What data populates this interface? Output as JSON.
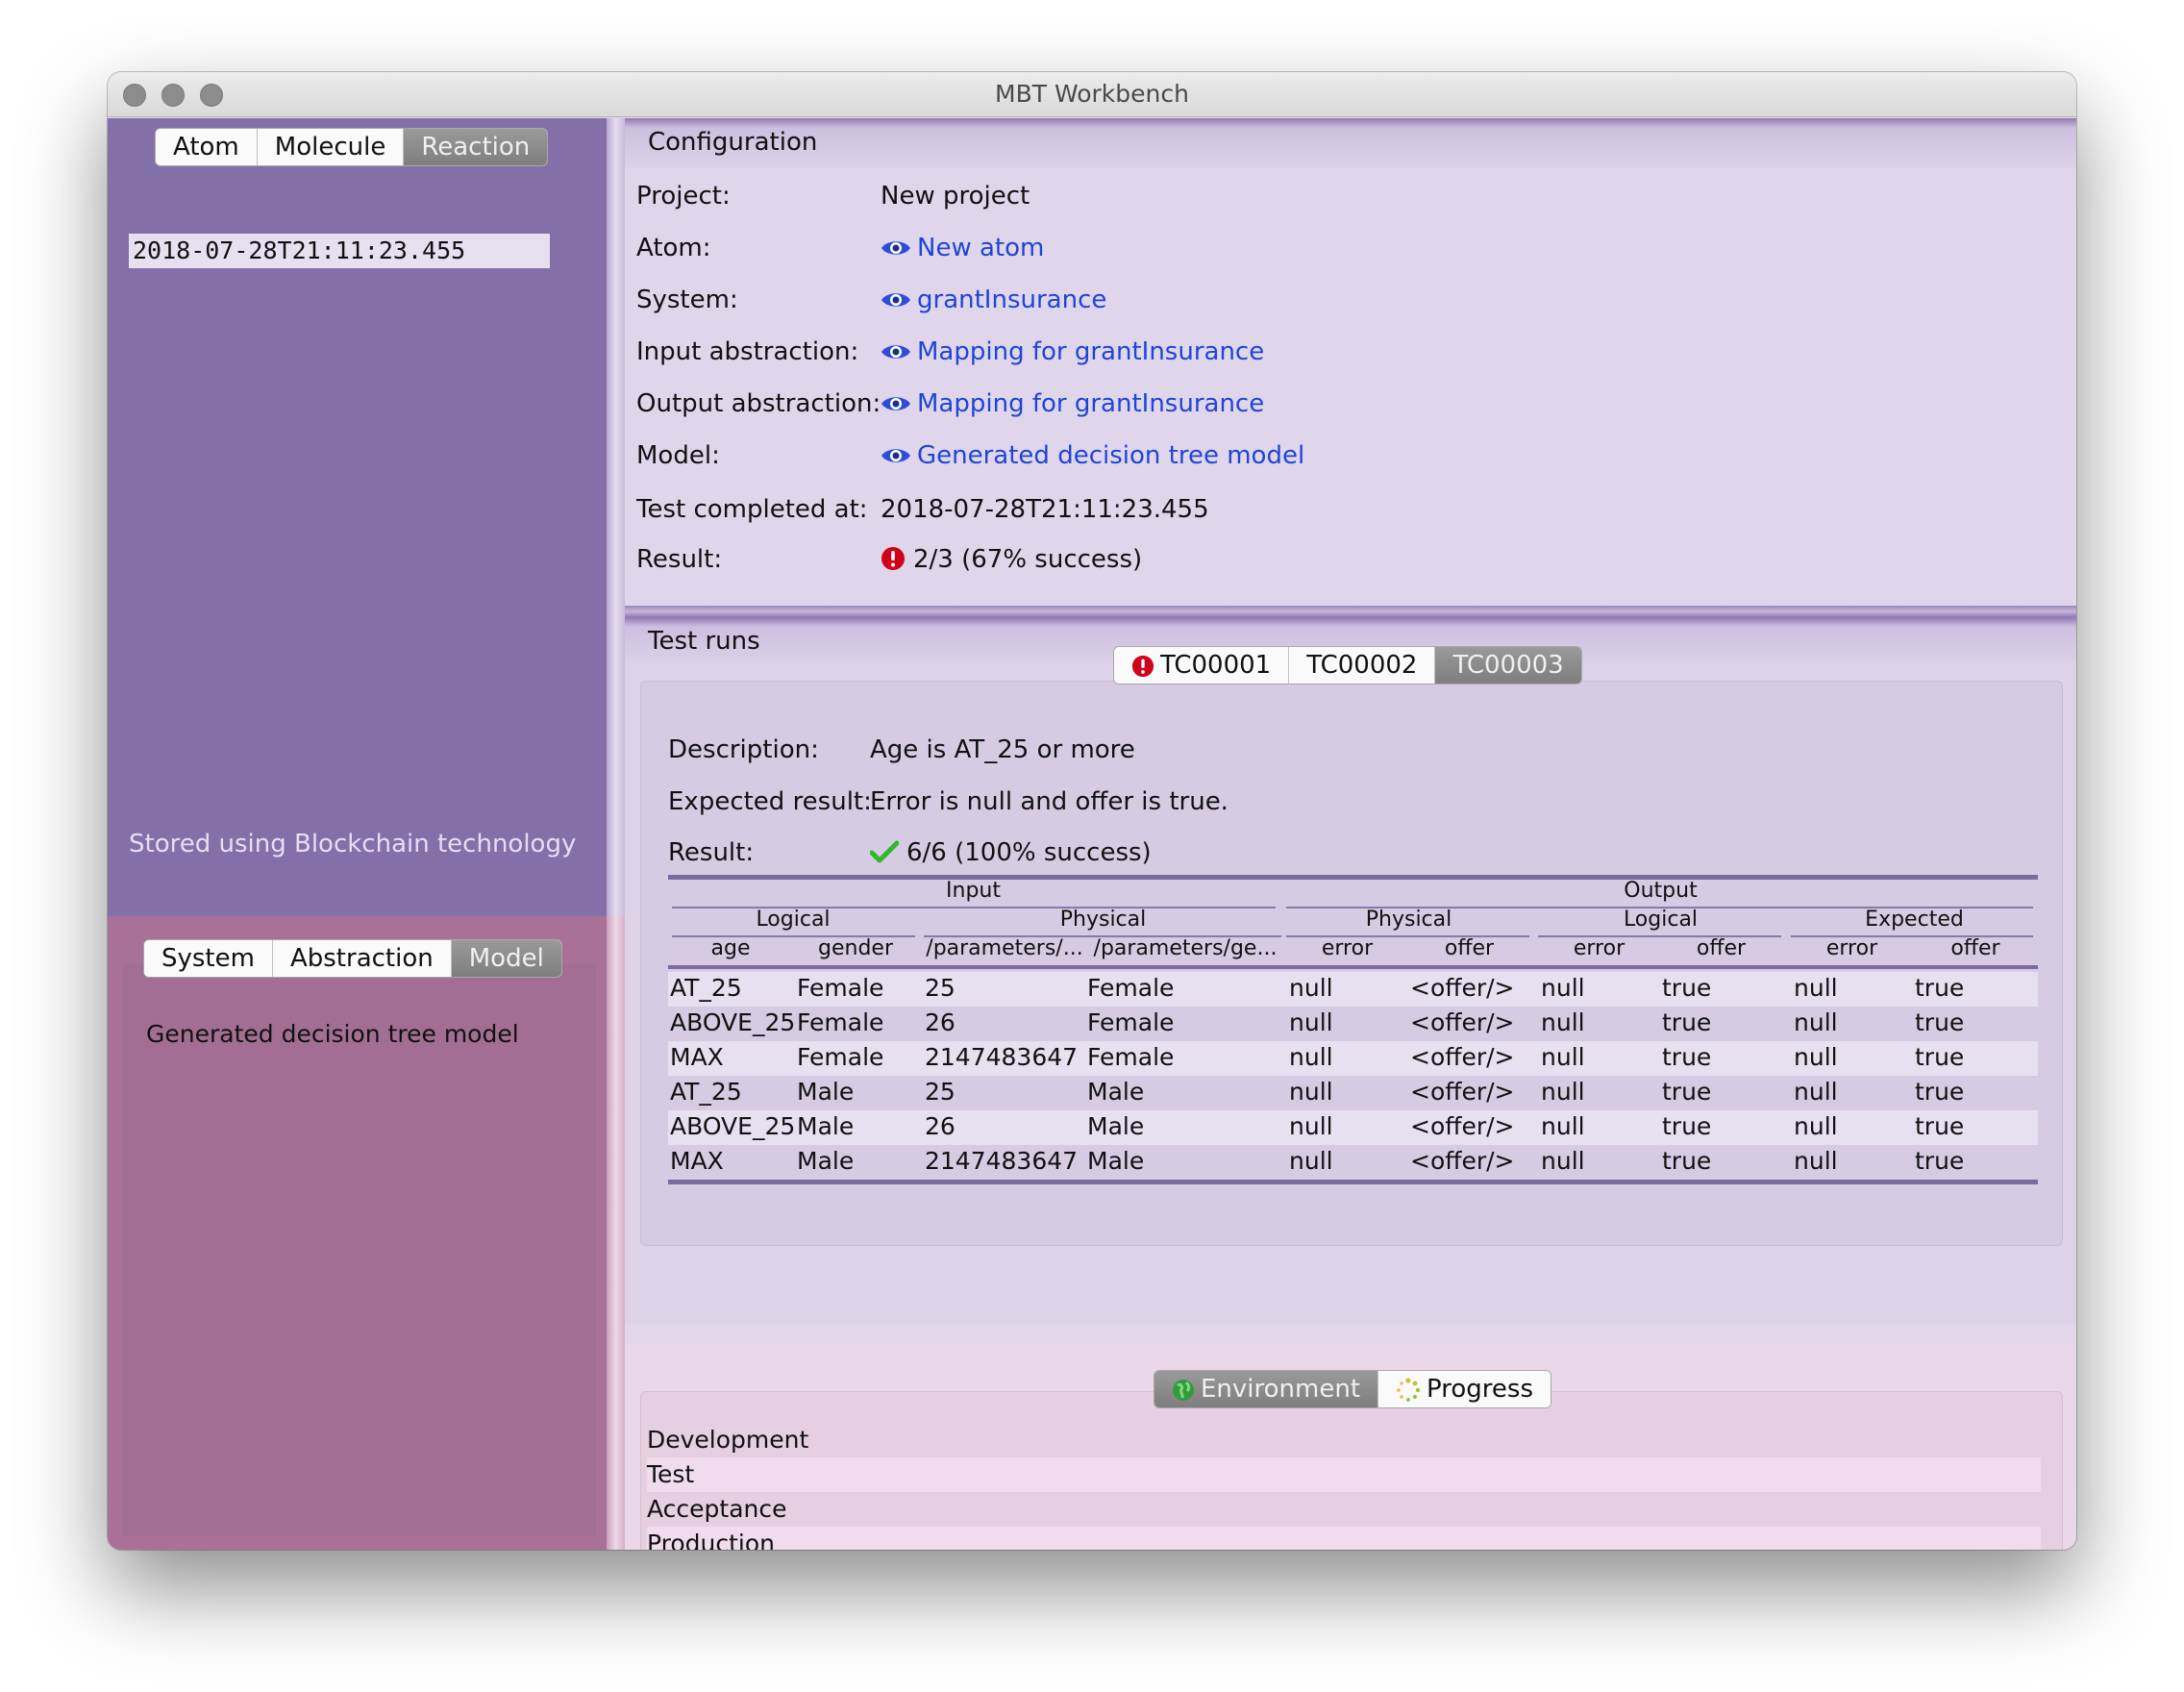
{
  "window": {
    "title": "MBT Workbench"
  },
  "left_top": {
    "tabs": [
      {
        "label": "Atom",
        "selected": false
      },
      {
        "label": "Molecule",
        "selected": false
      },
      {
        "label": "Reaction",
        "selected": true
      }
    ],
    "timestamp": "2018-07-28T21:11:23.455",
    "footer": "Stored using Blockchain technology"
  },
  "left_bottom": {
    "tabs": [
      {
        "label": "System",
        "selected": false
      },
      {
        "label": "Abstraction",
        "selected": false
      },
      {
        "label": "Model",
        "selected": true
      }
    ],
    "model_name": "Generated decision tree model"
  },
  "configuration": {
    "heading": "Configuration",
    "project_label": "Project:",
    "project_value": "New project",
    "atom_label": "Atom:",
    "atom_value": "New atom",
    "system_label": "System:",
    "system_value": "grantInsurance",
    "input_label": "Input abstraction:",
    "input_value": "Mapping for grantInsurance",
    "output_label": "Output abstraction:",
    "output_value": "Mapping for grantInsurance",
    "model_label": "Model:",
    "model_value": "Generated decision tree model",
    "completed_label": "Test completed at:",
    "completed_value": "2018-07-28T21:11:23.455",
    "result_label": "Result:",
    "result_value": "2/3 (67% success)",
    "result_status": "error",
    "link_color": "#1f45d6",
    "error_color": "#d0021b"
  },
  "test_runs": {
    "heading": "Test runs",
    "tabs": [
      {
        "label": "TC00001",
        "icon": "error-icon",
        "selected": false
      },
      {
        "label": "TC00002",
        "selected": false
      },
      {
        "label": "TC00003",
        "selected": true
      }
    ],
    "description_label": "Description:",
    "description_value": "Age is AT_25 or more",
    "expected_label": "Expected result:",
    "expected_value": "Error is null and offer is true.",
    "result_label": "Result:",
    "result_value": "6/6 (100% success)",
    "result_status": "success",
    "success_color": "#2fb82a",
    "table": {
      "group_input": "Input",
      "group_output": "Output",
      "sub_logical": "Logical",
      "sub_physical_in": "Physical",
      "sub_physical_out": "Physical",
      "sub_logical_out": "Logical",
      "sub_expected": "Expected",
      "columns": [
        "age",
        "gender",
        "/parameters/...",
        "/parameters/ge...",
        "error",
        "offer",
        "error",
        "offer",
        "error",
        "offer"
      ],
      "rows": [
        [
          "AT_25",
          "Female",
          "25",
          "Female",
          "null",
          "<offer/>",
          "null",
          "true",
          "null",
          "true"
        ],
        [
          "ABOVE_25",
          "Female",
          "26",
          "Female",
          "null",
          "<offer/>",
          "null",
          "true",
          "null",
          "true"
        ],
        [
          "MAX",
          "Female",
          "2147483647",
          "Female",
          "null",
          "<offer/>",
          "null",
          "true",
          "null",
          "true"
        ],
        [
          "AT_25",
          "Male",
          "25",
          "Male",
          "null",
          "<offer/>",
          "null",
          "true",
          "null",
          "true"
        ],
        [
          "ABOVE_25",
          "Male",
          "26",
          "Male",
          "null",
          "<offer/>",
          "null",
          "true",
          "null",
          "true"
        ],
        [
          "MAX",
          "Male",
          "2147483647",
          "Male",
          "null",
          "<offer/>",
          "null",
          "true",
          "null",
          "true"
        ]
      ]
    }
  },
  "environment": {
    "tabs": [
      {
        "label": "Environment",
        "icon": "globe-icon",
        "selected": true
      },
      {
        "label": "Progress",
        "icon": "spinner-icon",
        "selected": false
      }
    ],
    "items": [
      "Development",
      "Test",
      "Acceptance",
      "Production"
    ]
  }
}
